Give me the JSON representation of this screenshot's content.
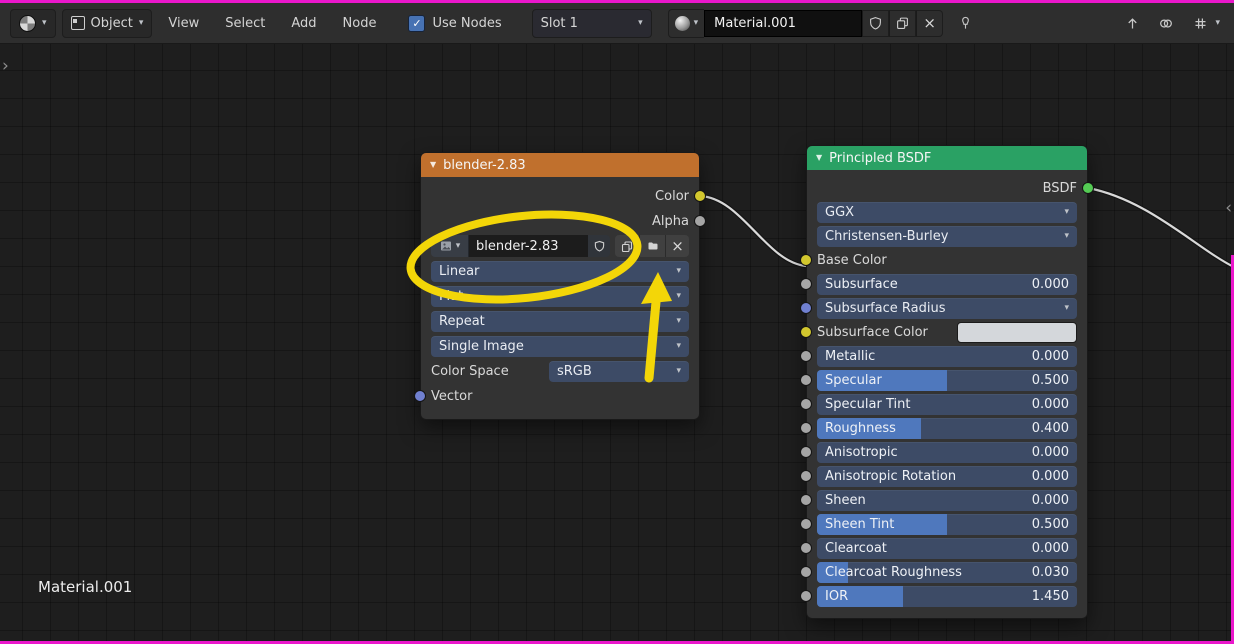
{
  "colors": {
    "accent_blue": "#4f78bd",
    "annotation_yellow": "#f3d608",
    "image_header_orange": "#c0702d",
    "bsdf_header_green": "#2aa164",
    "socket_yellow": "#d2c72e",
    "socket_gray": "#a5a5a5",
    "socket_purple": "#7080d0",
    "socket_green": "#54cb54",
    "noodle": "#d9d9d9"
  },
  "header": {
    "shader_type_label": "Object",
    "menus": [
      "View",
      "Select",
      "Add",
      "Node"
    ],
    "use_nodes_label": "Use Nodes",
    "use_nodes_checked": true,
    "check_glyph": "✓",
    "slot_label": "Slot 1",
    "material_name": "Material.001",
    "unlink_glyph": "×"
  },
  "image_node": {
    "title": "blender-2.83",
    "outputs": [
      {
        "label": "Color"
      },
      {
        "label": "Alpha"
      }
    ],
    "image_name": "blender-2.83",
    "interpolation": "Linear",
    "projection": "Flat",
    "extension": "Repeat",
    "source": "Single Image",
    "color_space_label": "Color Space",
    "color_space_value": "sRGB",
    "input_label": "Vector",
    "unlink_glyph": "×"
  },
  "bsdf_node": {
    "title": "Principled BSDF",
    "output_label": "BSDF",
    "distribution": "GGX",
    "subsurface_method": "Christensen-Burley",
    "rows": [
      {
        "label": "Base Color",
        "type": "label",
        "socket": "yellow"
      },
      {
        "label": "Subsurface",
        "type": "slider",
        "value": "0.000",
        "fill": 0,
        "socket": "gray"
      },
      {
        "label": "Subsurface Radius",
        "type": "dropdown",
        "socket": "purple"
      },
      {
        "label": "Subsurface Color",
        "type": "color",
        "swatch": "#d4d7db",
        "socket": "yellow"
      },
      {
        "label": "Metallic",
        "type": "slider",
        "value": "0.000",
        "fill": 0,
        "socket": "gray"
      },
      {
        "label": "Specular",
        "type": "slider",
        "value": "0.500",
        "fill": 0.5,
        "socket": "gray"
      },
      {
        "label": "Specular Tint",
        "type": "slider",
        "value": "0.000",
        "fill": 0,
        "socket": "gray"
      },
      {
        "label": "Roughness",
        "type": "slider",
        "value": "0.400",
        "fill": 0.4,
        "socket": "gray"
      },
      {
        "label": "Anisotropic",
        "type": "slider",
        "value": "0.000",
        "fill": 0,
        "socket": "gray"
      },
      {
        "label": "Anisotropic Rotation",
        "type": "slider",
        "value": "0.000",
        "fill": 0,
        "socket": "gray"
      },
      {
        "label": "Sheen",
        "type": "slider",
        "value": "0.000",
        "fill": 0,
        "socket": "gray"
      },
      {
        "label": "Sheen Tint",
        "type": "slider",
        "value": "0.500",
        "fill": 0.5,
        "socket": "gray"
      },
      {
        "label": "Clearcoat",
        "type": "slider",
        "value": "0.000",
        "fill": 0,
        "socket": "gray"
      },
      {
        "label": "Clearcoat Roughness",
        "type": "slider",
        "value": "0.030",
        "fill": 0.12,
        "socket": "gray"
      },
      {
        "label": "IOR",
        "type": "slider",
        "value": "1.450",
        "fill": 0.33,
        "socket": "gray"
      }
    ]
  },
  "footer_label": "Material.001",
  "glyphs": {
    "chevron_down": "▾",
    "collapse_triangle": "▼",
    "edge_left": "›",
    "edge_right": "‹"
  }
}
